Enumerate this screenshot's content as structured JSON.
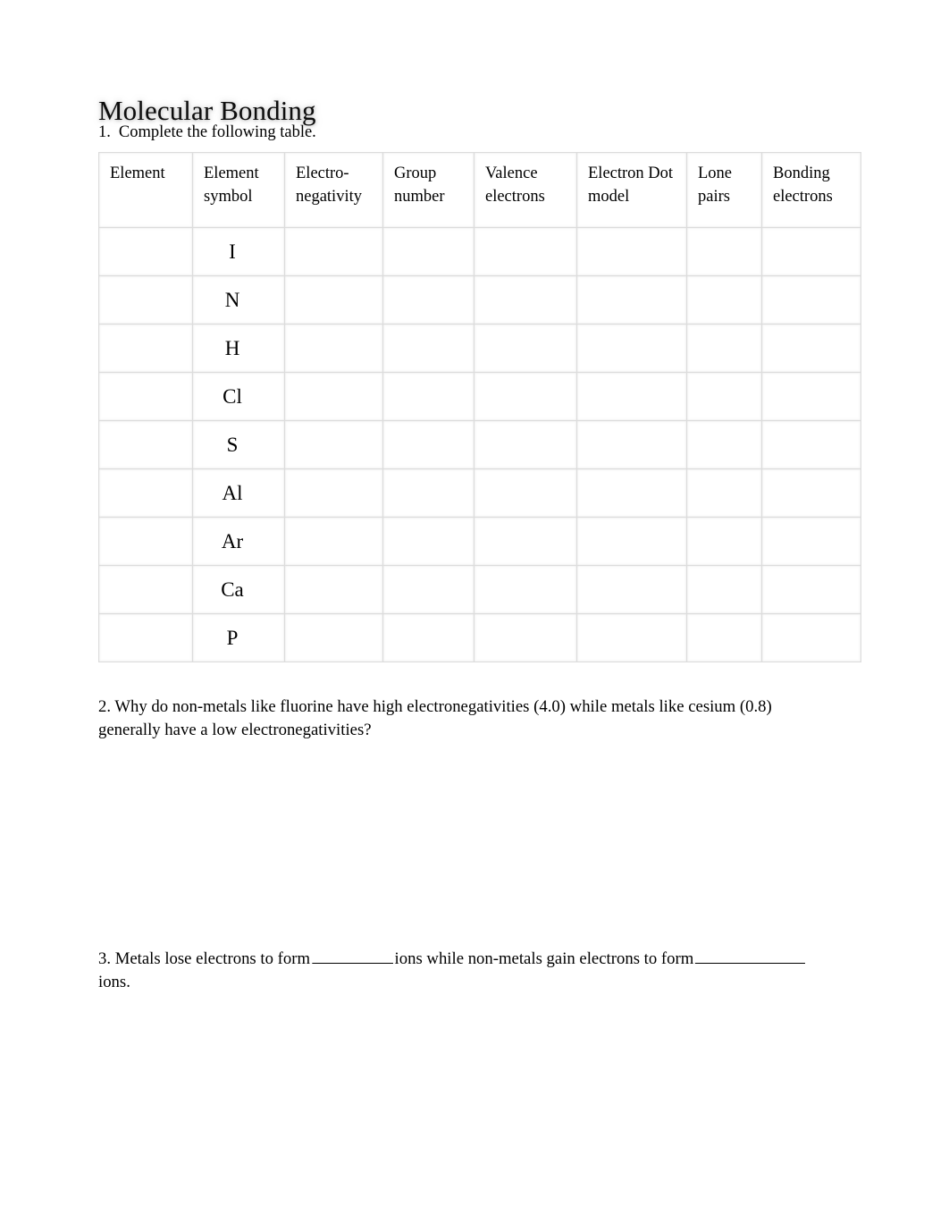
{
  "document": {
    "title": "Molecular Bonding"
  },
  "questions": {
    "q1": {
      "number": "1.",
      "text": "Complete the following table."
    },
    "q2": {
      "text": "2. Why do non-metals like fluorine have high electronegativities (4.0) while metals like cesium (0.8) generally have a low electronegativities?"
    },
    "q3": {
      "part_a": "3.  Metals lose electrons to form",
      "part_b": "ions while non-metals gain electrons to form",
      "part_c": "ions.",
      "blank_1": "",
      "blank_2": ""
    }
  },
  "table": {
    "headers": [
      {
        "line1": "Element",
        "line2": ""
      },
      {
        "line1": "Element",
        "line2": "symbol"
      },
      {
        "line1": "Electro-",
        "line2": "negativity"
      },
      {
        "line1": "Group",
        "line2": "number"
      },
      {
        "line1": "Valence",
        "line2": "electrons"
      },
      {
        "line1": "Electron Dot",
        "line2": "model"
      },
      {
        "line1": "Lone",
        "line2": "pairs"
      },
      {
        "line1": "Bonding",
        "line2": "electrons"
      }
    ],
    "rows": [
      {
        "element": "",
        "symbol": "I",
        "electronegativity": "",
        "group_number": "",
        "valence_electrons": "",
        "electron_dot_model": "",
        "lone_pairs": "",
        "bonding_electrons": ""
      },
      {
        "element": "",
        "symbol": "N",
        "electronegativity": "",
        "group_number": "",
        "valence_electrons": "",
        "electron_dot_model": "",
        "lone_pairs": "",
        "bonding_electrons": ""
      },
      {
        "element": "",
        "symbol": "H",
        "electronegativity": "",
        "group_number": "",
        "valence_electrons": "",
        "electron_dot_model": "",
        "lone_pairs": "",
        "bonding_electrons": ""
      },
      {
        "element": "",
        "symbol": "Cl",
        "electronegativity": "",
        "group_number": "",
        "valence_electrons": "",
        "electron_dot_model": "",
        "lone_pairs": "",
        "bonding_electrons": ""
      },
      {
        "element": "",
        "symbol": "S",
        "electronegativity": "",
        "group_number": "",
        "valence_electrons": "",
        "electron_dot_model": "",
        "lone_pairs": "",
        "bonding_electrons": ""
      },
      {
        "element": "",
        "symbol": "Al",
        "electronegativity": "",
        "group_number": "",
        "valence_electrons": "",
        "electron_dot_model": "",
        "lone_pairs": "",
        "bonding_electrons": ""
      },
      {
        "element": "",
        "symbol": "Ar",
        "electronegativity": "",
        "group_number": "",
        "valence_electrons": "",
        "electron_dot_model": "",
        "lone_pairs": "",
        "bonding_electrons": ""
      },
      {
        "element": "",
        "symbol": "Ca",
        "electronegativity": "",
        "group_number": "",
        "valence_electrons": "",
        "electron_dot_model": "",
        "lone_pairs": "",
        "bonding_electrons": ""
      },
      {
        "element": "",
        "symbol": "P",
        "electronegativity": "",
        "group_number": "",
        "valence_electrons": "",
        "electron_dot_model": "",
        "lone_pairs": "",
        "bonding_electrons": ""
      }
    ]
  },
  "colors": {
    "page_background": "#ffffff",
    "text": "#000000",
    "table_border": "#dcdcdc",
    "title_shadow": "#969696"
  }
}
